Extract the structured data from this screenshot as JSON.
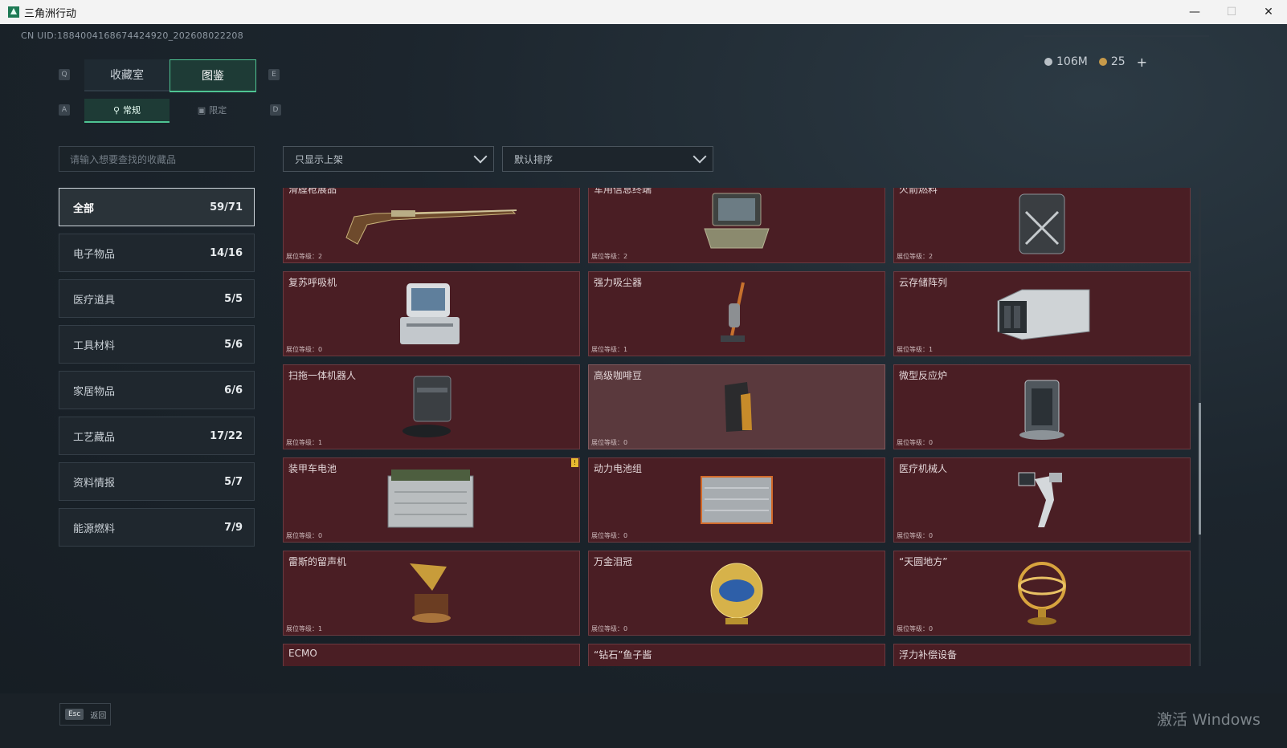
{
  "window": {
    "title": "三角洲行动"
  },
  "header": {
    "uid": "CN UID:1884004168674424920_202608022208"
  },
  "currency": {
    "silver": "106M",
    "gold": "25",
    "add_label": "+"
  },
  "key_hints": {
    "prev_main": "Q",
    "next_main": "E",
    "prev_sub": "A",
    "next_sub": "D"
  },
  "main_tabs": [
    {
      "label": "收藏室"
    },
    {
      "label": "图鉴"
    }
  ],
  "sub_tabs": [
    {
      "label": "常规"
    },
    {
      "label": "限定"
    }
  ],
  "search": {
    "placeholder": "请输入想要查找的收藏品"
  },
  "filters": {
    "shelf": "只显示上架",
    "sort": "默认排序"
  },
  "categories": [
    {
      "label": "全部",
      "count": "59/71"
    },
    {
      "label": "电子物品",
      "count": "14/16"
    },
    {
      "label": "医疗道具",
      "count": "5/5"
    },
    {
      "label": "工具材料",
      "count": "5/6"
    },
    {
      "label": "家居物品",
      "count": "6/6"
    },
    {
      "label": "工艺藏品",
      "count": "17/22"
    },
    {
      "label": "资料情报",
      "count": "5/7"
    },
    {
      "label": "能源燃料",
      "count": "7/9"
    }
  ],
  "items": [
    {
      "name": "滑膛枪展品",
      "level": "展位等级：2",
      "art": "rifle-image"
    },
    {
      "name": "军用信息终端",
      "level": "展位等级：2",
      "art": "terminal-image"
    },
    {
      "name": "火箭燃料",
      "level": "展位等级：2",
      "art": "fuel-can-image"
    },
    {
      "name": "复苏呼吸机",
      "level": "展位等级：0",
      "art": "ventilator-image"
    },
    {
      "name": "强力吸尘器",
      "level": "展位等级：1",
      "art": "vacuum-image"
    },
    {
      "name": "云存储阵列",
      "level": "展位等级：1",
      "art": "storage-array-image"
    },
    {
      "name": "扫拖一体机器人",
      "level": "展位等级：1",
      "art": "robot-vacuum-image"
    },
    {
      "name": "高级咖啡豆",
      "level": "展位等级：0",
      "art": "coffee-bag-image"
    },
    {
      "name": "微型反应炉",
      "level": "展位等级：0",
      "art": "reactor-image"
    },
    {
      "name": "装甲车电池",
      "level": "展位等级：0",
      "art": "battery-image",
      "warning": "!"
    },
    {
      "name": "动力电池组",
      "level": "展位等级：0",
      "art": "battery-pack-image"
    },
    {
      "name": "医疗机械人",
      "level": "展位等级：0",
      "art": "medical-robot-image"
    },
    {
      "name": "雷斯的留声机",
      "level": "展位等级：1",
      "art": "gramophone-image"
    },
    {
      "name": "万金泪冠",
      "level": "展位等级：0",
      "art": "jeweled-egg-image"
    },
    {
      "name": "“天圆地方”",
      "level": "展位等级：0",
      "art": "armillary-image"
    },
    {
      "name": "ECMO",
      "level": "",
      "art": "ecmo-image"
    },
    {
      "name": "“钻石”鱼子酱",
      "level": "",
      "art": "caviar-image"
    },
    {
      "name": "浮力补偿设备",
      "level": "",
      "art": "bcd-image"
    }
  ],
  "footer": {
    "esc_key": "Esc",
    "esc_label": "返回"
  },
  "watermark": "激活 Windows",
  "colors": {
    "accent": "#4fc493",
    "card_bg": "#4a1e24",
    "card_highlight": "#5a393d"
  }
}
